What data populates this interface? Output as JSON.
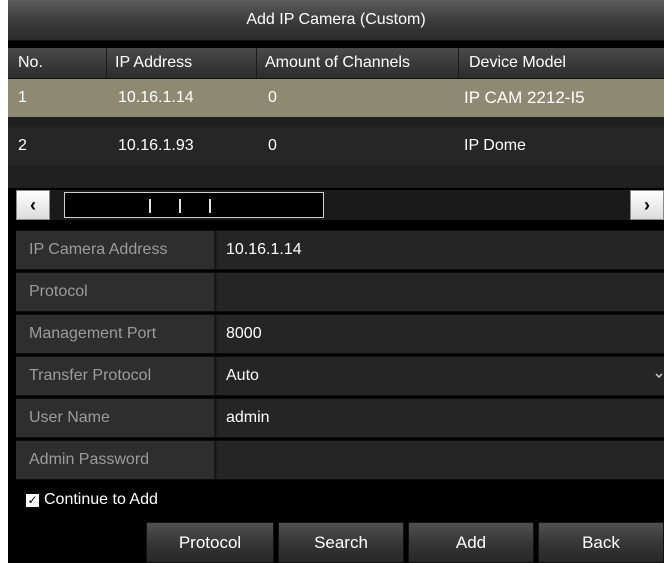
{
  "dialog": {
    "title": "Add IP Camera (Custom)"
  },
  "table": {
    "headers": [
      "No.",
      "IP Address",
      "Amount of Channels",
      "Device Model"
    ],
    "rows": [
      {
        "no": "1",
        "ip": "10.16.1.14",
        "channels": "0",
        "model": "IP CAM 2212-I5",
        "selected": true
      },
      {
        "no": "2",
        "ip": "10.16.1.93",
        "channels": "0",
        "model": "IP Dome",
        "selected": false
      }
    ]
  },
  "scrollbar": {
    "left_arrow": "‹",
    "right_arrow": "›"
  },
  "form": {
    "fields": [
      {
        "label": "IP Camera Address",
        "value": "10.16.1.14"
      },
      {
        "label": "Protocol",
        "value": ""
      },
      {
        "label": "Management Port",
        "value": "8000"
      },
      {
        "label": "Transfer Protocol",
        "value": "Auto"
      },
      {
        "label": "User Name",
        "value": "admin"
      },
      {
        "label": "Admin Password",
        "value": ""
      }
    ]
  },
  "continue_to_add": {
    "label": "Continue to Add",
    "checked": true,
    "check_mark": "✓"
  },
  "buttons": {
    "protocol": "Protocol",
    "search": "Search",
    "add": "Add",
    "back": "Back"
  },
  "colors": {
    "selected_row": "#8e8a72",
    "background": "#000000",
    "text": "#ffffff",
    "label_text": "#9c9c9c"
  },
  "icons": {
    "dropdown": "chevron-down-icon",
    "checkbox": "checkbox-checked-icon"
  }
}
